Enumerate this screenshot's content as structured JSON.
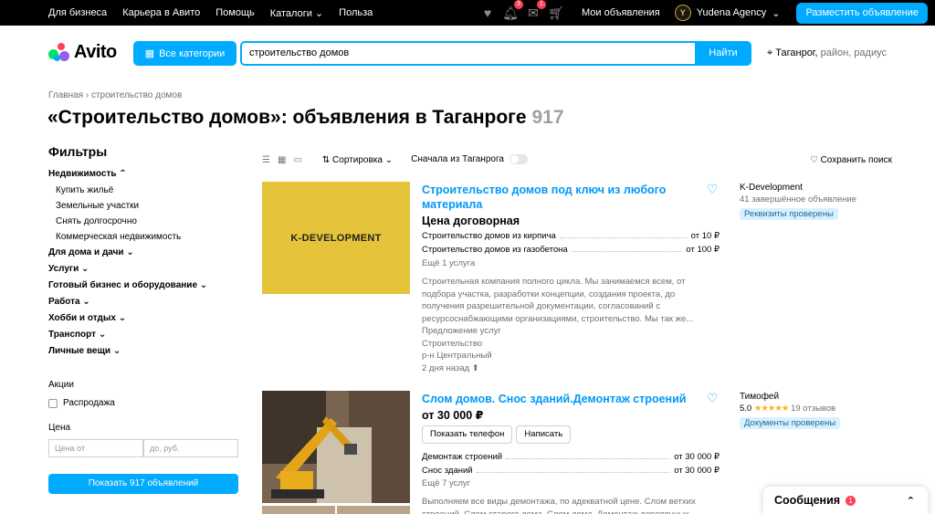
{
  "topbar": {
    "links": [
      "Для бизнеса",
      "Карьера в Авито",
      "Помощь",
      "Каталоги",
      "Польза"
    ],
    "catalogs_label": "Каталоги",
    "notif_badge": "3",
    "chat_badge": "1",
    "my_ads": "Мои объявления",
    "agency_logo": "Y",
    "agency": "Yudena Agency",
    "post_ad": "Разместить объявление"
  },
  "header": {
    "logo": "Avito",
    "categories": "Все категории",
    "search_value": "строительство домов",
    "find": "Найти",
    "location_city": "Таганрог,",
    "location_rest": " район, радиус"
  },
  "breadcrumbs": {
    "home": "Главная",
    "sep": "›",
    "current": "строительство домов"
  },
  "page_title": {
    "text": "«Строительство домов»: объявления в Таганроге",
    "count": "917"
  },
  "filters": {
    "title": "Фильтры",
    "realty": "Недвижимость",
    "realty_items": [
      "Купить жильё",
      "Земельные участки",
      "Снять долгосрочно",
      "Коммерческая недвижимость"
    ],
    "categories": [
      "Для дома и дачи",
      "Услуги",
      "Готовый бизнес и оборудование",
      "Работа",
      "Хобби и отдых",
      "Транспорт",
      "Личные вещи"
    ],
    "promos_label": "Акции",
    "sale_label": "Распродажа",
    "price_label": "Цена",
    "price_from": "Цена от",
    "price_to": "до, руб.",
    "show_btn": "Показать 917 объявлений"
  },
  "sortbar": {
    "sort": "Сортировка",
    "first_from": "Сначала из Таганрога",
    "save_search": "Сохранить поиск"
  },
  "listings": [
    {
      "image_text": "K-DEVELOPMENT",
      "title": "Строительство домов под ключ из любого материала",
      "price": "Цена договорная",
      "services": [
        {
          "name": "Строительство домов из кирпича",
          "price": "от 10 ₽"
        },
        {
          "name": "Строительство домов из газобетона",
          "price": "от 100 ₽"
        }
      ],
      "more": "Ещё 1 услуга",
      "description": "Строительная компания полного цикла. Мы занимаемся всем, от подбора участка, разработки концепции, создания проекта, до получения разрешительной документации, согласований с ресурсоснабжающими организациями, строительство. Мы так же...",
      "meta": [
        "Предложение услуг",
        "Строительство",
        "р-н Центральный"
      ],
      "date": "2 дня назад",
      "seller": "K-Development",
      "seller_sub": "41 завершённое объявление",
      "badge": "Реквизиты проверены"
    },
    {
      "title": "Слом домов. Снос зданий.Демонтаж строений",
      "price": "от 30 000 ₽",
      "show_phone": "Показать телефон",
      "write": "Написать",
      "services": [
        {
          "name": "Демонтаж строений",
          "price": "от 30 000 ₽"
        },
        {
          "name": "Снос зданий",
          "price": "от 30 000 ₽"
        }
      ],
      "more": "Ещё 7 услуг",
      "description": "Выполняем все виды демонтажа, по адекватной цене. Слом ветхих строений. Слом старого дома. Слом дома. Демонтаж деревянных",
      "seller": "Тимофей",
      "rating": "5.0",
      "stars": "★★★★★",
      "reviews": "19 отзывов",
      "badge": "Документы проверены"
    }
  ],
  "messages": {
    "label": "Сообщения",
    "count": "1"
  }
}
